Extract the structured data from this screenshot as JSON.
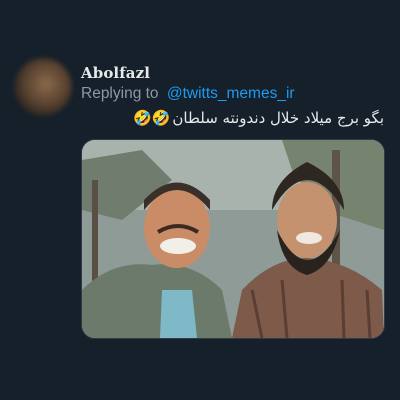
{
  "tweet": {
    "author_name": "Abolfazl",
    "reply_prefix": "Replying to",
    "reply_handle": "@twitts_memes_ir",
    "text": "بگو برج میلاد خلال دندونته سلطان",
    "emoji": "🤣🤣",
    "avatar_icon": "user-avatar",
    "media_description_icon": "photo-icon"
  },
  "colors": {
    "background": "#15202b",
    "text_primary": "#e7e9ea",
    "text_secondary": "#8b98a5",
    "link": "#1d9bf0"
  }
}
